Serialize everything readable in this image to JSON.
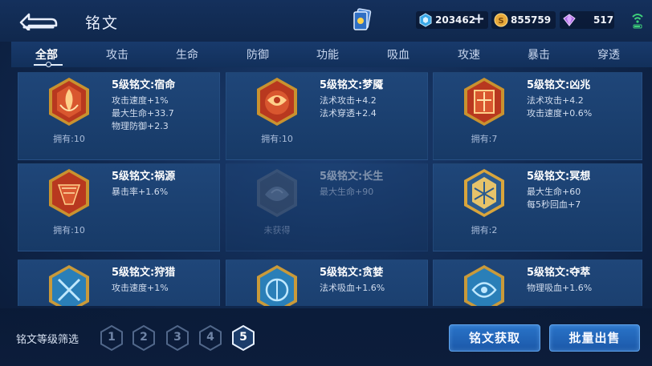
{
  "header": {
    "title": "铭文",
    "back_icon": "back-arrow-icon",
    "deck_icon": "inscription-deck-icon",
    "currencies": [
      {
        "name": "diamond",
        "icon": "diamond-gem-icon",
        "value": "203462",
        "has_plus": true
      },
      {
        "name": "gold",
        "icon": "gold-coin-icon",
        "value": "855759"
      },
      {
        "name": "crystal",
        "icon": "purple-crystal-icon",
        "value": "517"
      }
    ],
    "status_icon": "wifi-icon"
  },
  "tabs": [
    {
      "label": "全部",
      "active": true
    },
    {
      "label": "攻击"
    },
    {
      "label": "生命"
    },
    {
      "label": "防御"
    },
    {
      "label": "功能"
    },
    {
      "label": "吸血"
    },
    {
      "label": "攻速"
    },
    {
      "label": "暴击"
    },
    {
      "label": "穿透"
    }
  ],
  "inscriptions": [
    {
      "name": "5级铭文:宿命",
      "stats": [
        "攻击速度+1%",
        "最大生命+33.7",
        "物理防御+2.3"
      ],
      "owned": "拥有:10",
      "color": "red",
      "icon": "fate-emblem-icon"
    },
    {
      "name": "5级铭文:梦魇",
      "stats": [
        "法术攻击+4.2",
        "法术穿透+2.4"
      ],
      "owned": "拥有:10",
      "color": "red",
      "icon": "nightmare-emblem-icon"
    },
    {
      "name": "5级铭文:凶兆",
      "stats": [
        "法术攻击+4.2",
        "攻击速度+0.6%"
      ],
      "owned": "拥有:7",
      "color": "red",
      "icon": "omen-emblem-icon"
    },
    {
      "name": "5级铭文:祸源",
      "stats": [
        "暴击率+1.6%"
      ],
      "owned": "拥有:10",
      "color": "red",
      "icon": "calamity-emblem-icon"
    },
    {
      "name": "5级铭文:长生",
      "stats": [
        "最大生命+90"
      ],
      "owned": "未获得",
      "color": "gray",
      "icon": "longevity-emblem-icon",
      "locked": true
    },
    {
      "name": "5级铭文:冥想",
      "stats": [
        "最大生命+60",
        "每5秒回血+7"
      ],
      "owned": "拥有:2",
      "color": "gold",
      "icon": "meditation-emblem-icon"
    },
    {
      "name": "5级铭文:狩猎",
      "stats": [
        "攻击速度+1%"
      ],
      "owned": "",
      "color": "blue",
      "icon": "hunt-emblem-icon"
    },
    {
      "name": "5级铭文:贪婪",
      "stats": [
        "法术吸血+1.6%"
      ],
      "owned": "",
      "color": "blue",
      "icon": "greed-emblem-icon"
    },
    {
      "name": "5级铭文:夺萃",
      "stats": [
        "物理吸血+1.6%"
      ],
      "owned": "",
      "color": "blue",
      "icon": "extract-emblem-icon"
    }
  ],
  "footer": {
    "filter_label": "铭文等级筛选",
    "levels": [
      "1",
      "2",
      "3",
      "4",
      "5"
    ],
    "active_level": "5",
    "obtain_button": "铭文获取",
    "sell_button": "批量出售"
  },
  "colors": {
    "red": "#c8482c",
    "gold": "#d9a53c",
    "blue": "#3fa6d8",
    "accent": "#2a74c9"
  }
}
